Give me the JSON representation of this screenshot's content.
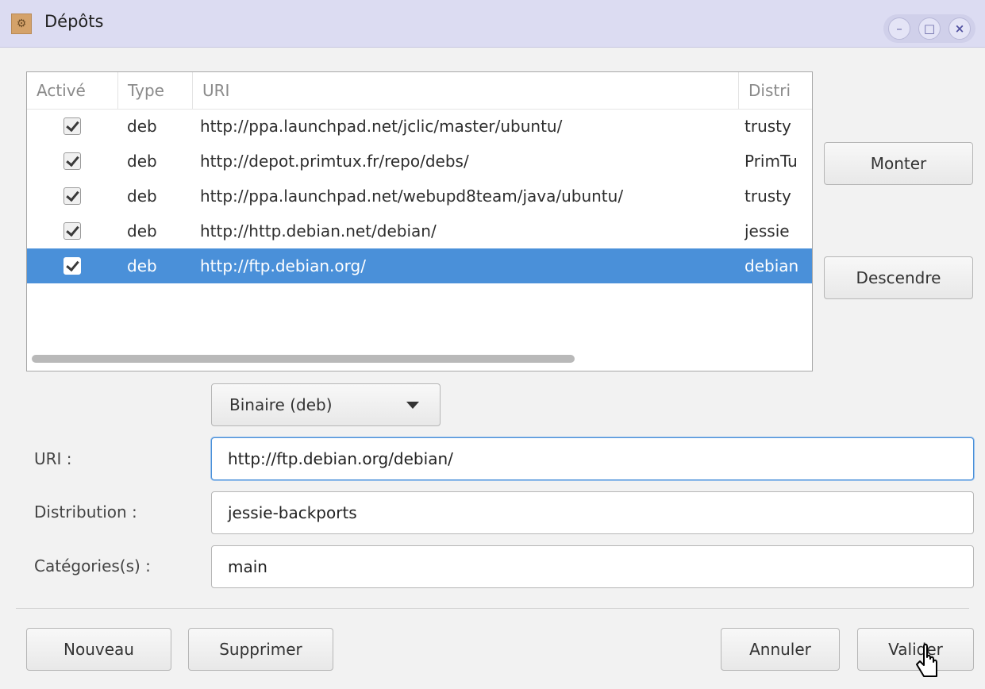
{
  "window": {
    "title": "Dépôts",
    "icon": "app-gear-icon",
    "controls": [
      "minimize-icon",
      "maximize-icon",
      "close-icon"
    ]
  },
  "list": {
    "columns": [
      "Activé",
      "Type",
      "URI",
      "Distri"
    ],
    "rows": [
      {
        "active": true,
        "type": "deb",
        "uri": "http://ppa.launchpad.net/jclic/master/ubuntu/",
        "dist": "trusty"
      },
      {
        "active": true,
        "type": "deb",
        "uri": "http://depot.primtux.fr/repo/debs/",
        "dist": "PrimTu"
      },
      {
        "active": true,
        "type": "deb",
        "uri": "http://ppa.launchpad.net/webupd8team/java/ubuntu/",
        "dist": "trusty"
      },
      {
        "active": true,
        "type": "deb",
        "uri": "http://http.debian.net/debian/",
        "dist": "jessie"
      },
      {
        "active": true,
        "type": "deb",
        "uri": "http://ftp.debian.org/",
        "dist": "debian"
      }
    ],
    "selected_index": 4
  },
  "side_buttons": {
    "up": "Monter",
    "down": "Descendre"
  },
  "form": {
    "type_combo": "Binaire (deb)",
    "uri_label": "URI :",
    "uri_value": "http://ftp.debian.org/debian/",
    "dist_label": "Distribution :",
    "dist_value": "jessie-backports",
    "cat_label": "Catégories(s) :",
    "cat_value": "main"
  },
  "bottom_buttons": {
    "new": "Nouveau",
    "delete": "Supprimer",
    "cancel": "Annuler",
    "ok": "Valider"
  },
  "colors": {
    "selection": "#4a90d9",
    "titlebar": "#dcdcf2",
    "focus": "#4a90d9"
  }
}
